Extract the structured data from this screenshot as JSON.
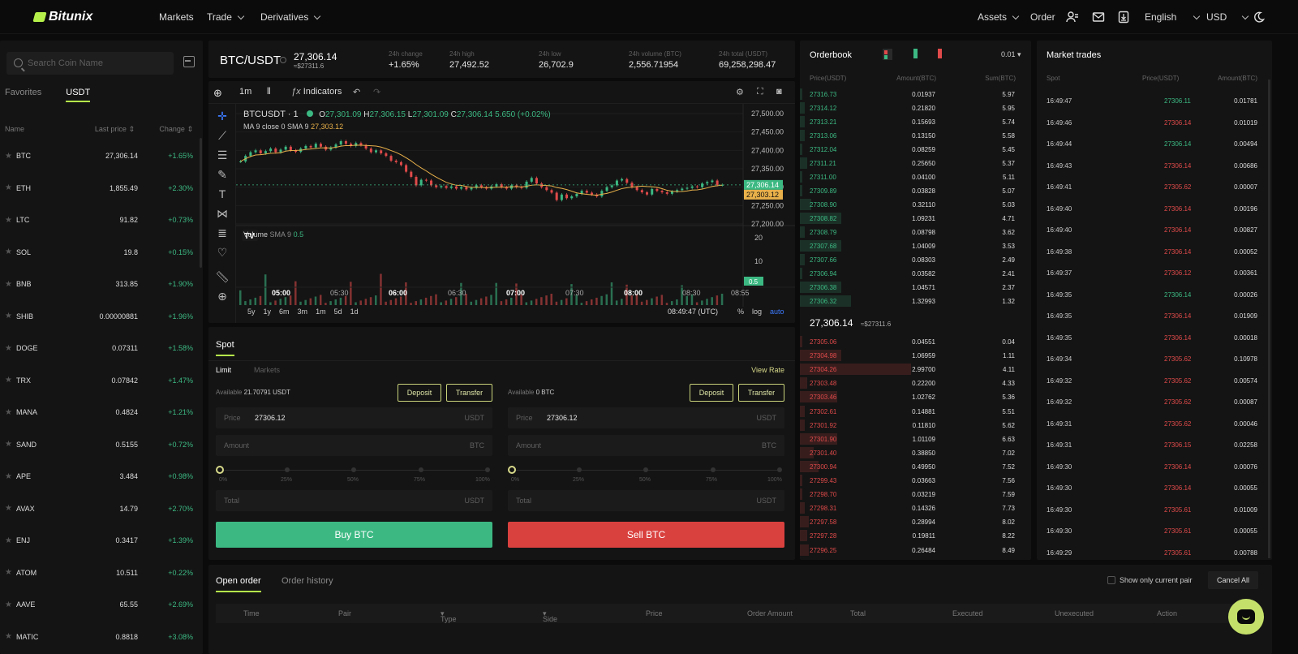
{
  "nav": {
    "brand": "Bitunix",
    "markets": "Markets",
    "trade": "Trade",
    "derivatives": "Derivatives",
    "assets": "Assets",
    "order": "Order",
    "language": "English",
    "currency": "USD"
  },
  "sidebar": {
    "search_placeholder": "Search Coin Name",
    "tabs": [
      "Favorites",
      "USDT"
    ],
    "col_name": "Name",
    "col_last": "Last price",
    "col_change": "Change",
    "coins": [
      {
        "sym": "BTC",
        "price": "27,306.14",
        "chg": "+1.65%"
      },
      {
        "sym": "ETH",
        "price": "1,855.49",
        "chg": "+2.30%"
      },
      {
        "sym": "LTC",
        "price": "91.82",
        "chg": "+0.73%"
      },
      {
        "sym": "SOL",
        "price": "19.8",
        "chg": "+0.15%"
      },
      {
        "sym": "BNB",
        "price": "313.85",
        "chg": "+1.90%"
      },
      {
        "sym": "SHIB",
        "price": "0.00000881",
        "chg": "+1.96%"
      },
      {
        "sym": "DOGE",
        "price": "0.07311",
        "chg": "+1.58%"
      },
      {
        "sym": "TRX",
        "price": "0.07842",
        "chg": "+1.47%"
      },
      {
        "sym": "MANA",
        "price": "0.4824",
        "chg": "+1.21%"
      },
      {
        "sym": "SAND",
        "price": "0.5155",
        "chg": "+0.72%"
      },
      {
        "sym": "APE",
        "price": "3.484",
        "chg": "+0.98%"
      },
      {
        "sym": "AVAX",
        "price": "14.79",
        "chg": "+2.70%"
      },
      {
        "sym": "ENJ",
        "price": "0.3417",
        "chg": "+1.39%"
      },
      {
        "sym": "ATOM",
        "price": "10.511",
        "chg": "+0.22%"
      },
      {
        "sym": "AAVE",
        "price": "65.55",
        "chg": "+2.69%"
      },
      {
        "sym": "MATIC",
        "price": "0.8818",
        "chg": "+3.08%"
      }
    ]
  },
  "ticker": {
    "pair": "BTC/USDT",
    "last": "27,306.14",
    "last_usd": "≈$27311.6",
    "stats": [
      {
        "label": "24h change",
        "value": "+1.65%",
        "green": true
      },
      {
        "label": "24h high",
        "value": "27,492.52"
      },
      {
        "label": "24h low",
        "value": "26,702.9"
      },
      {
        "label": "24h volume (BTC)",
        "value": "2,556.71954"
      },
      {
        "label": "24h total (USDT)",
        "value": "69,258,298.47"
      }
    ]
  },
  "chart": {
    "interval": "1m",
    "indicators": "Indicators",
    "symbol": "BTCUSDT · 1",
    "o": "27,301.09",
    "h": "27,306.15",
    "l": "27,301.09",
    "c": "27,306.14",
    "change": "5.650 (+0.02%)",
    "ma_label": "MA 9 close 0 SMA 9",
    "ma_value": "27,303.12",
    "volume_label": "Volume",
    "volume_sma": "SMA 9",
    "volume_value": "0.5",
    "ranges": [
      "5y",
      "1y",
      "6m",
      "3m",
      "1m",
      "5d",
      "1d"
    ],
    "time": "08:49:47 (UTC)",
    "opts": [
      "%",
      "log",
      "auto"
    ],
    "last_tag": "27,306.14",
    "ma_tag": "27,303.12",
    "vol_tag": "0.5",
    "green": "#3cb983",
    "red": "#e04a4a",
    "ma_color": "#e8b04a"
  },
  "chart_data": {
    "type": "candlestick",
    "y_ticks": [
      "27,500.00",
      "27,450.00",
      "27,400.00",
      "27,350.00",
      "27,300.00",
      "27,250.00",
      "27,200.00"
    ],
    "ylim": [
      27200,
      27500
    ],
    "x_ticks": [
      "05:00",
      "05:30",
      "06:00",
      "06:30",
      "07:00",
      "07:30",
      "08:00",
      "08:30",
      "08:55"
    ],
    "volume_ticks": [
      "20",
      "10"
    ],
    "close_path": [
      27370,
      27385,
      27395,
      27400,
      27392,
      27398,
      27405,
      27395,
      27402,
      27410,
      27400,
      27396,
      27405,
      27412,
      27408,
      27418,
      27410,
      27402,
      27408,
      27416,
      27425,
      27418,
      27412,
      27420,
      27414,
      27405,
      27395,
      27400,
      27392,
      27385,
      27372,
      27368,
      27360,
      27342,
      27328,
      27305,
      27320,
      27318,
      27305,
      27300,
      27303,
      27298,
      27302,
      27296,
      27300,
      27294,
      27298,
      27305,
      27300,
      27296,
      27302,
      27308,
      27300,
      27296,
      27305,
      27300,
      27298,
      27315,
      27325,
      27310,
      27300,
      27292,
      27285,
      27265,
      27280,
      27270,
      27275,
      27282,
      27290,
      27285,
      27280,
      27275,
      27290,
      27300,
      27305,
      27318,
      27322,
      27312,
      27300,
      27292,
      27286,
      27280,
      27295,
      27290,
      27286,
      27282,
      27288,
      27292,
      27296,
      27298,
      27302,
      27300,
      27310,
      27314,
      27318,
      27306,
      27306
    ]
  },
  "orderbook": {
    "title": "Orderbook",
    "precision": "0.01",
    "cols": [
      "Price(USDT)",
      "Amount(BTC)",
      "Sum(BTC)"
    ],
    "asks": [
      {
        "p": "27316.73",
        "a": "0.01937",
        "s": "5.97",
        "d": 0.01
      },
      {
        "p": "27314.12",
        "a": "0.21820",
        "s": "5.95",
        "d": 0.02
      },
      {
        "p": "27313.21",
        "a": "0.15693",
        "s": "5.74",
        "d": 0.02
      },
      {
        "p": "27313.06",
        "a": "0.13150",
        "s": "5.58",
        "d": 0.02
      },
      {
        "p": "27312.04",
        "a": "0.08259",
        "s": "5.45",
        "d": 0.01
      },
      {
        "p": "27311.21",
        "a": "0.25650",
        "s": "5.37",
        "d": 0.03
      },
      {
        "p": "27311.00",
        "a": "0.04100",
        "s": "5.11",
        "d": 0.01
      },
      {
        "p": "27309.89",
        "a": "0.03828",
        "s": "5.07",
        "d": 0.01
      },
      {
        "p": "27308.90",
        "a": "0.32110",
        "s": "5.03",
        "d": 0.05
      },
      {
        "p": "27308.82",
        "a": "1.09231",
        "s": "4.71",
        "d": 0.18
      },
      {
        "p": "27308.79",
        "a": "0.08798",
        "s": "3.62",
        "d": 0.02
      },
      {
        "p": "27307.68",
        "a": "1.04009",
        "s": "3.53",
        "d": 0.18
      },
      {
        "p": "27307.66",
        "a": "0.08303",
        "s": "2.49",
        "d": 0.02
      },
      {
        "p": "27306.94",
        "a": "0.03582",
        "s": "2.41",
        "d": 0.01
      },
      {
        "p": "27306.38",
        "a": "1.04571",
        "s": "2.37",
        "d": 0.18
      },
      {
        "p": "27306.32",
        "a": "1.32993",
        "s": "1.32",
        "d": 0.22
      }
    ],
    "mid": "27,306.14",
    "mid_usd": "≈$27311.6",
    "bids": [
      {
        "p": "27305.06",
        "a": "0.04551",
        "s": "0.04",
        "d": 0.01
      },
      {
        "p": "27304.98",
        "a": "1.06959",
        "s": "1.11",
        "d": 0.18
      },
      {
        "p": "27304.26",
        "a": "2.99700",
        "s": "4.11",
        "d": 0.48
      },
      {
        "p": "27303.48",
        "a": "0.22200",
        "s": "4.33",
        "d": 0.03
      },
      {
        "p": "27303.46",
        "a": "1.02762",
        "s": "5.36",
        "d": 0.16
      },
      {
        "p": "27302.61",
        "a": "0.14881",
        "s": "5.51",
        "d": 0.02
      },
      {
        "p": "27301.92",
        "a": "0.11810",
        "s": "5.62",
        "d": 0.02
      },
      {
        "p": "27301.90",
        "a": "1.01109",
        "s": "6.63",
        "d": 0.16
      },
      {
        "p": "27301.40",
        "a": "0.38850",
        "s": "7.02",
        "d": 0.06
      },
      {
        "p": "27300.94",
        "a": "0.49950",
        "s": "7.52",
        "d": 0.08
      },
      {
        "p": "27299.43",
        "a": "0.03663",
        "s": "7.56",
        "d": 0.01
      },
      {
        "p": "27298.70",
        "a": "0.03219",
        "s": "7.59",
        "d": 0.01
      },
      {
        "p": "27298.31",
        "a": "0.14326",
        "s": "7.73",
        "d": 0.02
      },
      {
        "p": "27297.58",
        "a": "0.28994",
        "s": "8.02",
        "d": 0.04
      },
      {
        "p": "27297.28",
        "a": "0.19811",
        "s": "8.22",
        "d": 0.03
      },
      {
        "p": "27296.25",
        "a": "0.26484",
        "s": "8.49",
        "d": 0.04
      }
    ]
  },
  "trades": {
    "title": "Market trades",
    "cols": [
      "Spot",
      "Price(USDT)",
      "Amount(BTC)"
    ],
    "rows": [
      {
        "t": "16:49:47",
        "p": "27306.11",
        "a": "0.01781",
        "g": true
      },
      {
        "t": "16:49:46",
        "p": "27306.14",
        "a": "0.01019",
        "g": false
      },
      {
        "t": "16:49:44",
        "p": "27306.14",
        "a": "0.00494",
        "g": true
      },
      {
        "t": "16:49:43",
        "p": "27306.14",
        "a": "0.00686",
        "g": false
      },
      {
        "t": "16:49:41",
        "p": "27305.62",
        "a": "0.00007",
        "g": false
      },
      {
        "t": "16:49:40",
        "p": "27306.14",
        "a": "0.00196",
        "g": false
      },
      {
        "t": "16:49:40",
        "p": "27306.14",
        "a": "0.00827",
        "g": false
      },
      {
        "t": "16:49:38",
        "p": "27306.14",
        "a": "0.00052",
        "g": false
      },
      {
        "t": "16:49:37",
        "p": "27306.12",
        "a": "0.00361",
        "g": false
      },
      {
        "t": "16:49:35",
        "p": "27306.14",
        "a": "0.00026",
        "g": true
      },
      {
        "t": "16:49:35",
        "p": "27306.14",
        "a": "0.01909",
        "g": false
      },
      {
        "t": "16:49:35",
        "p": "27306.14",
        "a": "0.00018",
        "g": false
      },
      {
        "t": "16:49:34",
        "p": "27305.62",
        "a": "0.10978",
        "g": false
      },
      {
        "t": "16:49:32",
        "p": "27305.62",
        "a": "0.00574",
        "g": false
      },
      {
        "t": "16:49:32",
        "p": "27305.62",
        "a": "0.00087",
        "g": false
      },
      {
        "t": "16:49:31",
        "p": "27305.62",
        "a": "0.00046",
        "g": false
      },
      {
        "t": "16:49:31",
        "p": "27306.15",
        "a": "0.02258",
        "g": false
      },
      {
        "t": "16:49:30",
        "p": "27306.14",
        "a": "0.00076",
        "g": false
      },
      {
        "t": "16:49:30",
        "p": "27306.14",
        "a": "0.00055",
        "g": false
      },
      {
        "t": "16:49:30",
        "p": "27305.61",
        "a": "0.01009",
        "g": false
      },
      {
        "t": "16:49:30",
        "p": "27305.61",
        "a": "0.00055",
        "g": false
      },
      {
        "t": "16:49:29",
        "p": "27305.61",
        "a": "0.00788",
        "g": false
      }
    ]
  },
  "spot": {
    "tab": "Spot",
    "limit": "Limit",
    "markets": "Markets",
    "view_rate": "View Rate",
    "available_label": "Available",
    "deposit": "Deposit",
    "transfer": "Transfer",
    "price_label": "Price",
    "amount_label": "Amount",
    "total_label": "Total",
    "pcts": [
      "0%",
      "25%",
      "50%",
      "75%",
      "100%"
    ],
    "buy": {
      "available": "21.70791 USDT",
      "price": "27306.12",
      "price_unit": "USDT",
      "amount_unit": "BTC",
      "total_unit": "USDT",
      "button": "Buy BTC"
    },
    "sell": {
      "available": "0 BTC",
      "price": "27306.12",
      "price_unit": "USDT",
      "amount_unit": "BTC",
      "total_unit": "USDT",
      "button": "Sell BTC"
    }
  },
  "orders": {
    "tab_open": "Open order",
    "tab_history": "Order history",
    "only_current": "Show only current pair",
    "cancel_all": "Cancel All",
    "cols": [
      "Time",
      "Pair",
      "Type",
      "Side",
      "Price",
      "Order Amount",
      "Total",
      "Executed",
      "Unexecuted",
      "Action"
    ]
  }
}
